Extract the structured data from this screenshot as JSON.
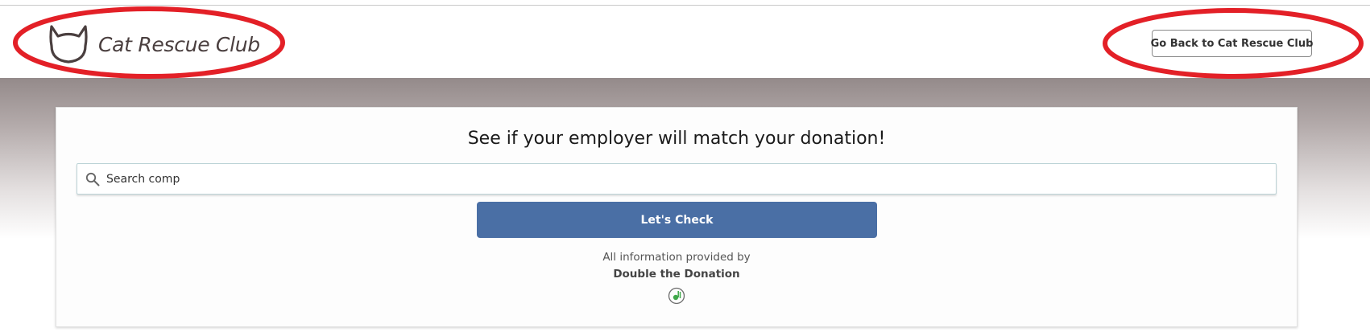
{
  "header": {
    "logo_text": "Cat Rescue Club",
    "logo_icon": "cat-head-icon",
    "back_button_label": "Go Back to Cat Rescue Club"
  },
  "main": {
    "title": "See if your employer will match your donation!",
    "search": {
      "value": "Search comp",
      "icon": "search-icon"
    },
    "check_button_label": "Let's Check",
    "provided_by_text": "All information provided by",
    "provider_name": "Double the Donation",
    "provider_icon": "double-the-donation-logo-icon"
  },
  "colors": {
    "primary_button": "#4a6fa5",
    "annotation_circle": "#e32027",
    "hero_gradient_top": "#948a8a",
    "logo_text": "#4a3f3f"
  }
}
